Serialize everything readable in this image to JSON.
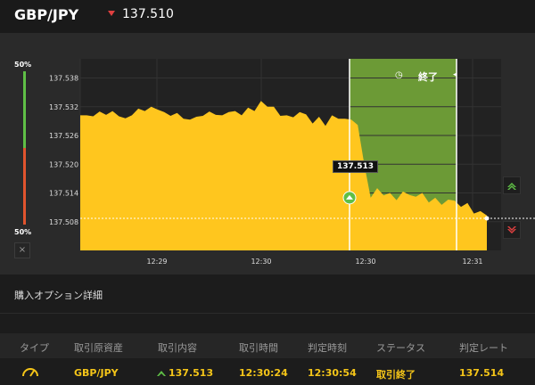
{
  "header": {
    "pair": "GBP/JPY",
    "current_price": "137.510",
    "trend_color": "#e04040"
  },
  "chart_data": {
    "type": "area",
    "series_color": "#ffc61e",
    "purchase_window_color": "#6c9a36",
    "y_ticks": [
      "137.538",
      "137.532",
      "137.526",
      "137.520",
      "137.514",
      "137.508"
    ],
    "x_ticks": [
      "12:29",
      "12:30",
      "12:30",
      "12:31"
    ],
    "ylim": [
      137.502,
      137.542
    ],
    "gauge": {
      "top_label": "50%",
      "bottom_label": "50%",
      "close_label": "×",
      "up_fraction": 0.5
    },
    "window_label": "終了",
    "entry_tooltip": "137.513",
    "current_line": 137.5087,
    "values": [
      137.5302,
      137.5302,
      137.53,
      137.531,
      137.5303,
      137.5311,
      137.53,
      137.5296,
      137.5302,
      137.5316,
      137.5311,
      137.532,
      137.5314,
      137.5309,
      137.5301,
      137.5307,
      137.5295,
      137.5293,
      137.5299,
      137.5301,
      137.531,
      137.5303,
      137.5302,
      137.5309,
      137.5311,
      137.5302,
      137.5318,
      137.5311,
      137.5332,
      137.532,
      137.532,
      137.5301,
      137.5302,
      137.5298,
      137.5309,
      137.5304,
      137.5285,
      137.5299,
      137.528,
      137.5302,
      137.5295,
      137.5295,
      137.5293,
      137.5282,
      137.52,
      137.513,
      137.515,
      137.5135,
      137.514,
      137.5125,
      137.5143,
      137.5136,
      137.5132,
      137.514,
      137.512,
      137.513,
      137.5115,
      137.5126,
      137.5124,
      137.5111,
      137.5119,
      137.5097,
      137.5102,
      137.5093
    ]
  },
  "side_buttons": {
    "high_color": "#5fbf46",
    "low_color": "#e04040"
  },
  "details": {
    "title": "購入オプション詳細",
    "columns": [
      "タイプ",
      "取引原資産",
      "取引内容",
      "取引時間",
      "判定時刻",
      "ステータス",
      "判定レート"
    ],
    "row": {
      "type_icon": "gauge-icon",
      "asset": "GBP/JPY",
      "direction_icon": "up-arrow-icon",
      "trade_rate": "137.513",
      "trade_time": "12:30:24",
      "judge_time": "12:30:54",
      "status": "取引終了",
      "judge_rate": "137.514"
    }
  }
}
